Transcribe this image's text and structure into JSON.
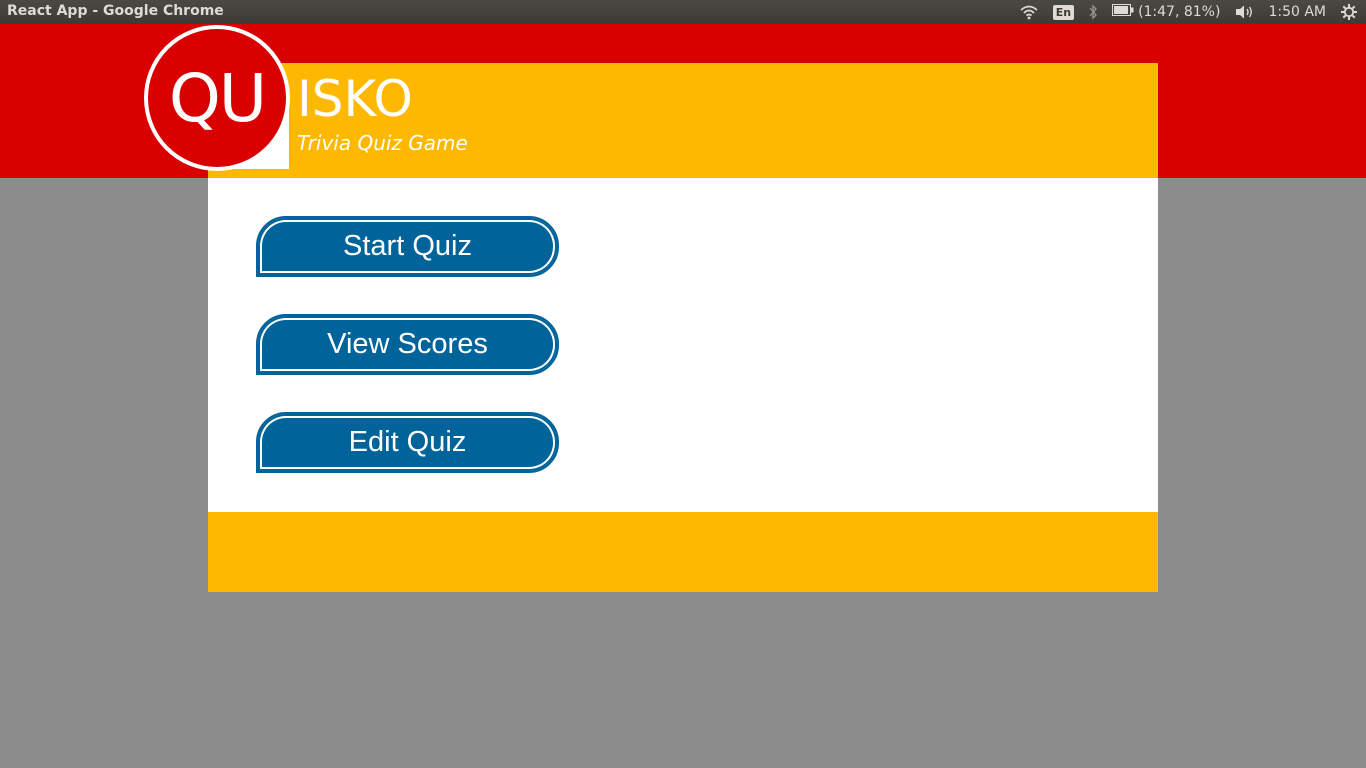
{
  "window": {
    "title": "React App - Google Chrome"
  },
  "system_tray": {
    "wifi_icon": "wifi-icon",
    "language": "En",
    "bluetooth_icon": "bluetooth-icon",
    "battery_icon": "battery-icon",
    "battery_text": "(1:47, 81%)",
    "volume_icon": "volume-icon",
    "clock": "1:50 AM",
    "settings_icon": "gear-icon"
  },
  "brand": {
    "logo_text": "QU",
    "name": "ISKO",
    "tagline": "Trivia Quiz Game"
  },
  "menu": {
    "start_label": "Start Quiz",
    "scores_label": "View Scores",
    "edit_label": "Edit Quiz"
  },
  "colors": {
    "red": "#d90000",
    "yellow": "#ffb800",
    "button_blue": "#00639a",
    "background_gray": "#8c8c8c"
  }
}
